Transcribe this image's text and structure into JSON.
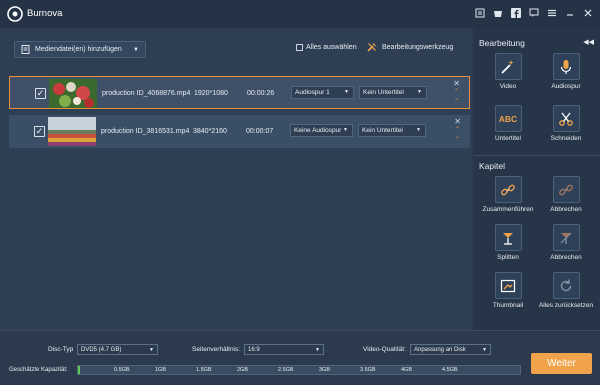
{
  "app": {
    "title": "Burnova"
  },
  "toolbar": {
    "add_label": "Mediendatei(en) hinzufügen",
    "select_all_label": "Alles auswählen",
    "edit_tool_label": "Bearbeitungswerkzeug"
  },
  "rows": [
    {
      "filename": "production ID_4068876.mp4",
      "resolution": "1920*1080",
      "duration": "00:00:26",
      "audio": "Audiospur 1",
      "subtitle": "Kein Untertitel",
      "checked": true,
      "selected": true
    },
    {
      "filename": "production ID_3816531.mp4",
      "resolution": "3840*2160",
      "duration": "00:00:07",
      "audio": "Keine Audiospur",
      "subtitle": "Kein Untertitel",
      "checked": true,
      "selected": false
    }
  ],
  "sidebar": {
    "edit_heading": "Bearbeitung",
    "edit_tools": [
      {
        "label": "Video"
      },
      {
        "label": "Audiospur"
      },
      {
        "label": "Untertitel"
      },
      {
        "label": "Schneiden"
      }
    ],
    "chapter_heading": "Kapitel",
    "chapter_tools": [
      {
        "label": "Zusammenführen"
      },
      {
        "label": "Abbrechen"
      },
      {
        "label": "Splitten"
      },
      {
        "label": "Abbrechen"
      },
      {
        "label": "Thumbnail"
      },
      {
        "label": "Alles zurücksetzen"
      }
    ],
    "subtitle_icon_text": "ABC"
  },
  "bottom": {
    "disc_type_label": "Disc-Typ",
    "disc_type_value": "DVD5 (4.7 GB)",
    "aspect_label": "Seitenverhältnis:",
    "aspect_value": "16:9",
    "quality_label": "Video-Qualität:",
    "quality_value": "Anpassung an Disk",
    "capacity_label": "Geschätzte Kapazität:",
    "capacity_ticks": [
      "0.5GB",
      "1GB",
      "1.5GB",
      "2GB",
      "2.5GB",
      "3GB",
      "3.5GB",
      "4GB",
      "4.5GB"
    ],
    "capacity_fraction": 0.005,
    "next_label": "Weiter"
  },
  "colors": {
    "accent": "#f0a34a",
    "capacity": "#5fcf4f",
    "selection_border": "#e9913a"
  }
}
